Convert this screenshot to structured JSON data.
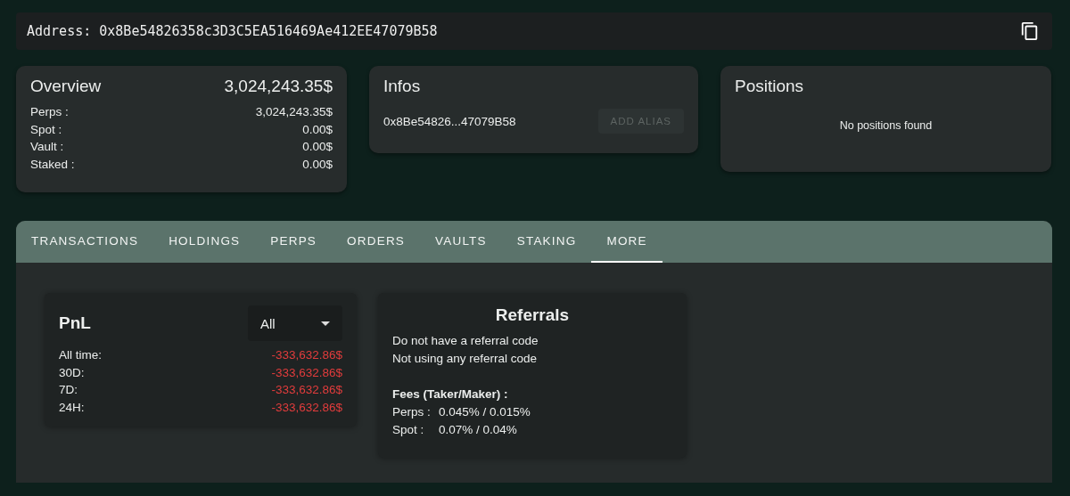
{
  "address_bar": {
    "label": "Address:",
    "address": "0x8Be54826358c3D3C5EA516469Ae412EE47079B58"
  },
  "overview": {
    "title": "Overview",
    "total": "3,024,243.35$",
    "rows": [
      {
        "label": "Perps :",
        "value": "3,024,243.35$"
      },
      {
        "label": "Spot :",
        "value": "0.00$"
      },
      {
        "label": "Vault :",
        "value": "0.00$"
      },
      {
        "label": "Staked :",
        "value": "0.00$"
      }
    ]
  },
  "infos": {
    "title": "Infos",
    "short_address": "0x8Be54826...47079B58",
    "button": {
      "label": "ADD ALIAS",
      "disabled": true
    }
  },
  "positions": {
    "title": "Positions",
    "empty_message": "No positions found"
  },
  "tabs": [
    {
      "label": "TRANSACTIONS",
      "selected": false
    },
    {
      "label": "HOLDINGS",
      "selected": false
    },
    {
      "label": "PERPS",
      "selected": false
    },
    {
      "label": "ORDERS",
      "selected": false
    },
    {
      "label": "VAULTS",
      "selected": false
    },
    {
      "label": "STAKING",
      "selected": false
    },
    {
      "label": "MORE",
      "selected": true
    }
  ],
  "pnl": {
    "title": "PnL",
    "period_select": "All",
    "rows": [
      {
        "label": "All time:",
        "value": "-333,632.86$"
      },
      {
        "label": "30D:",
        "value": "-333,632.86$"
      },
      {
        "label": "7D:",
        "value": "-333,632.86$"
      },
      {
        "label": "24H:",
        "value": "-333,632.86$"
      }
    ]
  },
  "referrals": {
    "title": "Referrals",
    "lines": [
      "Do not have a referral code",
      "Not using any referral code"
    ],
    "fees_title": "Fees (Taker/Maker) :",
    "fees": [
      {
        "label": "Perps :",
        "value": "0.045% / 0.015%"
      },
      {
        "label": "Spot :",
        "value": "0.07% / 0.04%"
      }
    ]
  }
}
